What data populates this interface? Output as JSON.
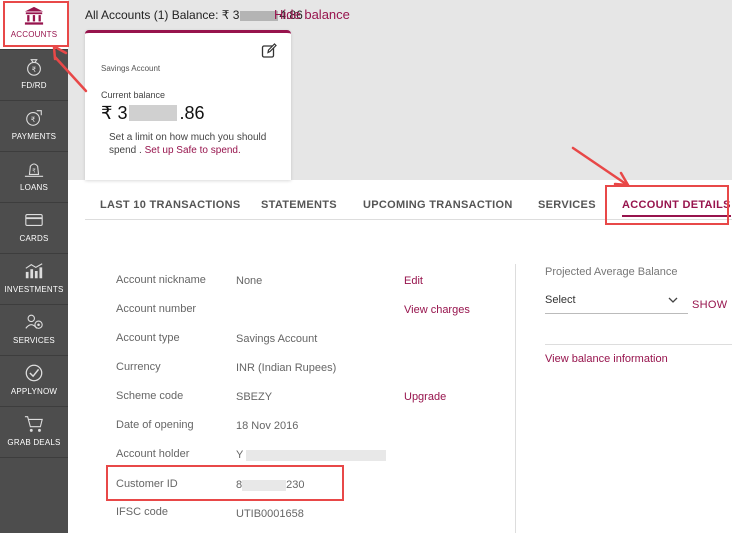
{
  "sidebar": {
    "items": [
      {
        "label": "ACCOUNTS",
        "icon": "bank-icon",
        "active": true
      },
      {
        "label": "FD/RD",
        "icon": "money-bag-icon"
      },
      {
        "label": "PAYMENTS",
        "icon": "payment-icon"
      },
      {
        "label": "LOANS",
        "icon": "loan-icon"
      },
      {
        "label": "CARDS",
        "icon": "card-icon"
      },
      {
        "label": "INVESTMENTS",
        "icon": "investments-icon"
      },
      {
        "label": "SERVICES",
        "icon": "services-icon"
      },
      {
        "label": "APPLYNOW",
        "icon": "checkmark-icon"
      },
      {
        "label": "GRAB DEALS",
        "icon": "cart-icon"
      }
    ]
  },
  "header": {
    "balance_prefix": "All Accounts (1) Balance: ₹ 3",
    "balance_suffix": "4.86",
    "hide_balance": "Hide balance"
  },
  "card": {
    "title": "Savings Account",
    "current_balance_label": "Current balance",
    "balance_prefix": "₹ 3",
    "balance_suffix": ".86",
    "limit_text": "Set a limit on how much you should spend . ",
    "limit_link": "Set up Safe to spend."
  },
  "tabs": [
    "LAST 10 TRANSACTIONS",
    "STATEMENTS",
    "UPCOMING TRANSACTION",
    "SERVICES",
    "ACCOUNT DETAILS"
  ],
  "details": [
    {
      "label": "Account nickname",
      "value": "None",
      "link": "Edit"
    },
    {
      "label": "Account number",
      "value": "",
      "link": "View charges"
    },
    {
      "label": "Account type",
      "value": "Savings Account",
      "link": ""
    },
    {
      "label": "Currency",
      "value": "INR (Indian Rupees)",
      "link": ""
    },
    {
      "label": "Scheme code",
      "value": "SBEZY",
      "link": "Upgrade"
    },
    {
      "label": "Date of opening",
      "value": "18 Nov 2016",
      "link": ""
    },
    {
      "label": "Account holder",
      "value": "Y",
      "link": ""
    },
    {
      "label": "Customer ID",
      "value_prefix": "8",
      "value_suffix": "230"
    },
    {
      "label": "IFSC code",
      "value": "UTIB0001658",
      "link": ""
    }
  ],
  "projected": {
    "title": "Projected Average Balance",
    "select_value": "Select",
    "show": "SHOW",
    "view_balance_info": "View balance information"
  },
  "colors": {
    "brand": "#97144d",
    "sidebar": "#4d4d4d",
    "annotation": "#e84848"
  }
}
